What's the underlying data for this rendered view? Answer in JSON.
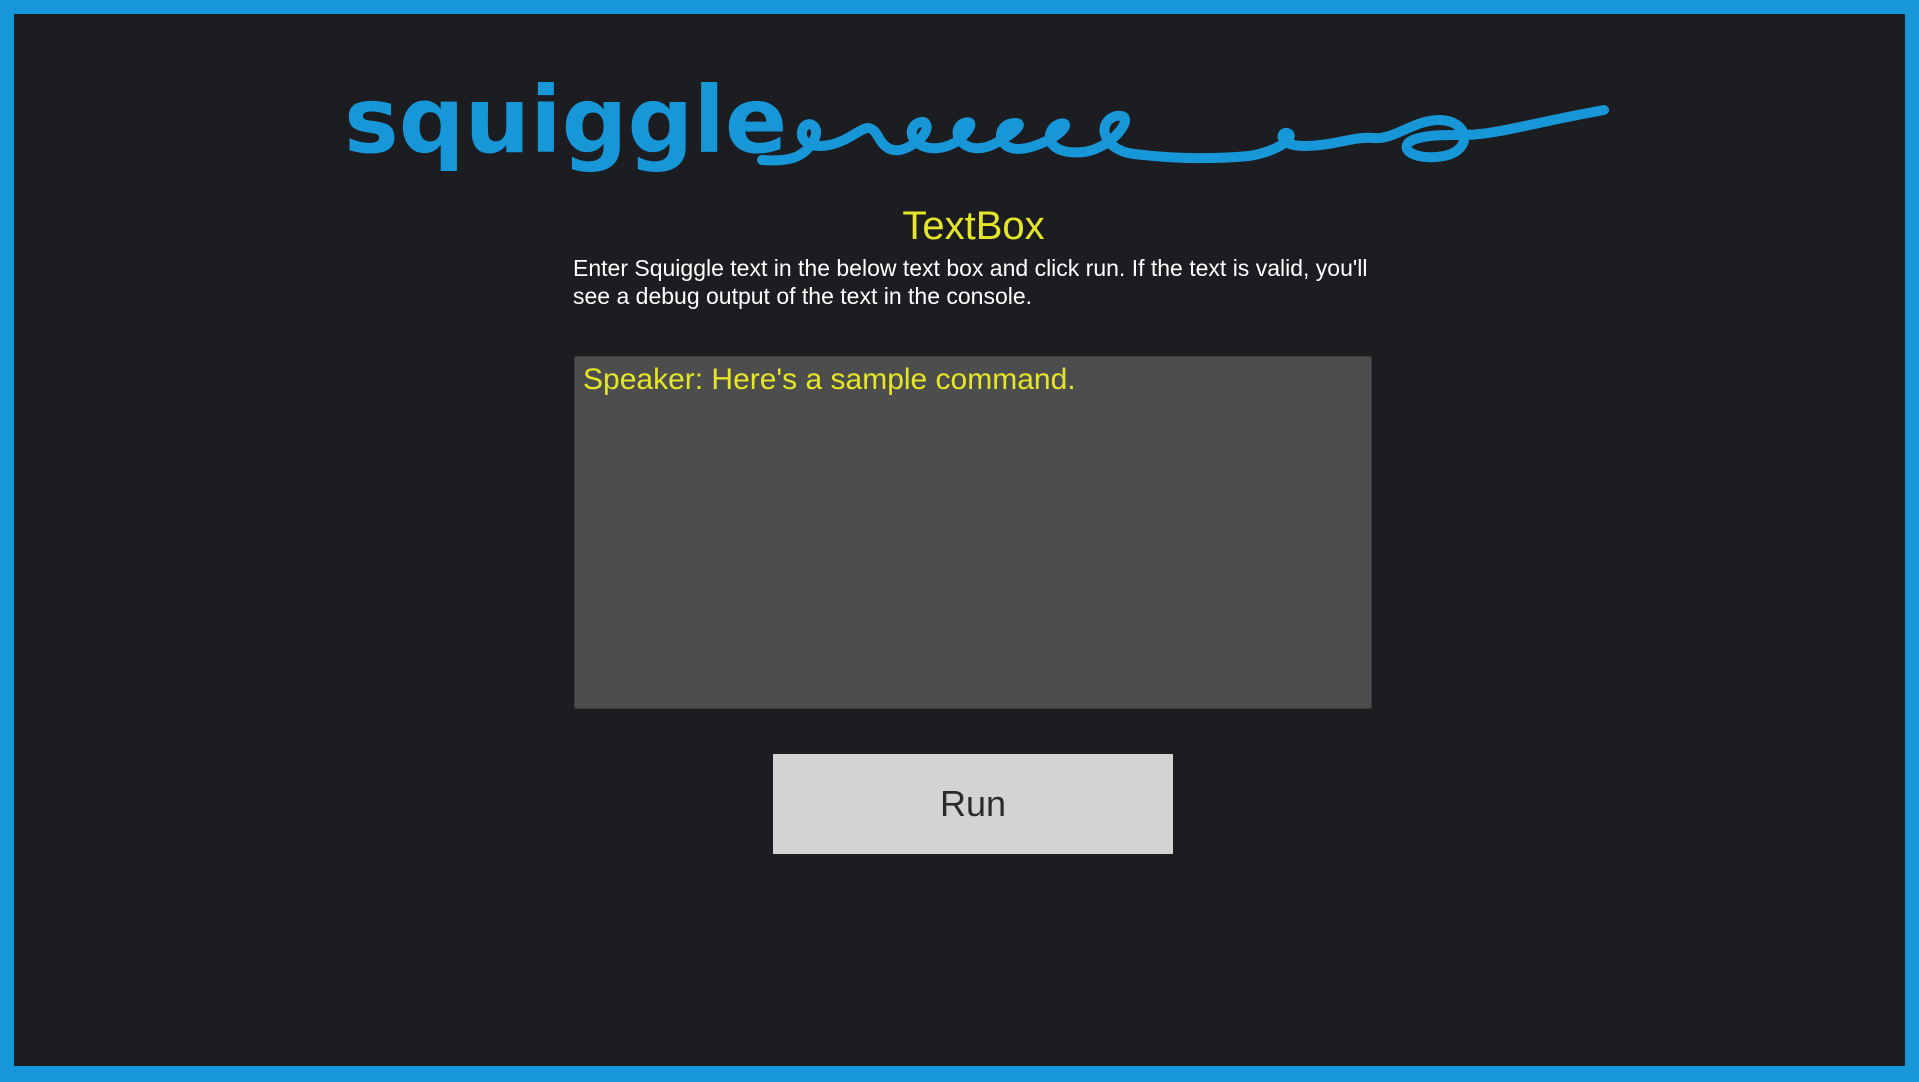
{
  "logo": {
    "text": "squiggle",
    "color": "#1796d8"
  },
  "colors": {
    "frame": "#1796d8",
    "background": "#1c1d21",
    "accent_text": "#e6e629",
    "textbox_bg": "#4d4d4d",
    "button_bg": "#d3d3d3"
  },
  "page": {
    "title": "TextBox",
    "description": "Enter Squiggle text in the below text box and click run. If the text is valid, you'll see a debug output of the text in the console."
  },
  "editor": {
    "value": "Speaker: Here's a sample command."
  },
  "run_button": {
    "label": "Run"
  }
}
